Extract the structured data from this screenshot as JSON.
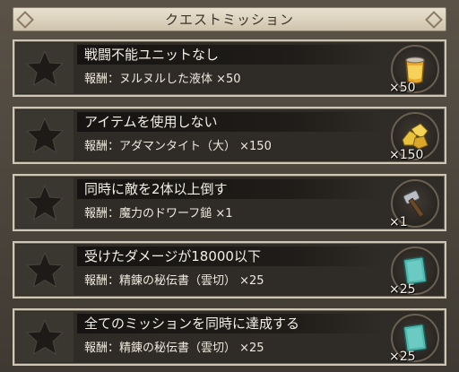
{
  "header": {
    "title": "クエストミッション"
  },
  "missions": [
    {
      "title": "戦闘不能ユニットなし",
      "reward": "報酬：ヌルヌルした液体 ×50",
      "qty": "×50",
      "icon": "liquid-jar-icon"
    },
    {
      "title": "アイテムを使用しない",
      "reward": "報酬：アダマンタイト（大） ×150",
      "qty": "×150",
      "icon": "gold-ore-icon"
    },
    {
      "title": "同時に敵を2体以上倒す",
      "reward": "報酬：魔力のドワーフ鎚 ×1",
      "qty": "×1",
      "icon": "hammer-icon"
    },
    {
      "title": "受けたダメージが18000以下",
      "reward": "報酬：精錬の秘伝書（雲切） ×25",
      "qty": "×25",
      "icon": "scroll-book-icon"
    },
    {
      "title": "全てのミッションを同時に達成する",
      "reward": "報酬：精錬の秘伝書（雲切） ×25",
      "qty": "×25",
      "icon": "scroll-book-icon"
    }
  ]
}
